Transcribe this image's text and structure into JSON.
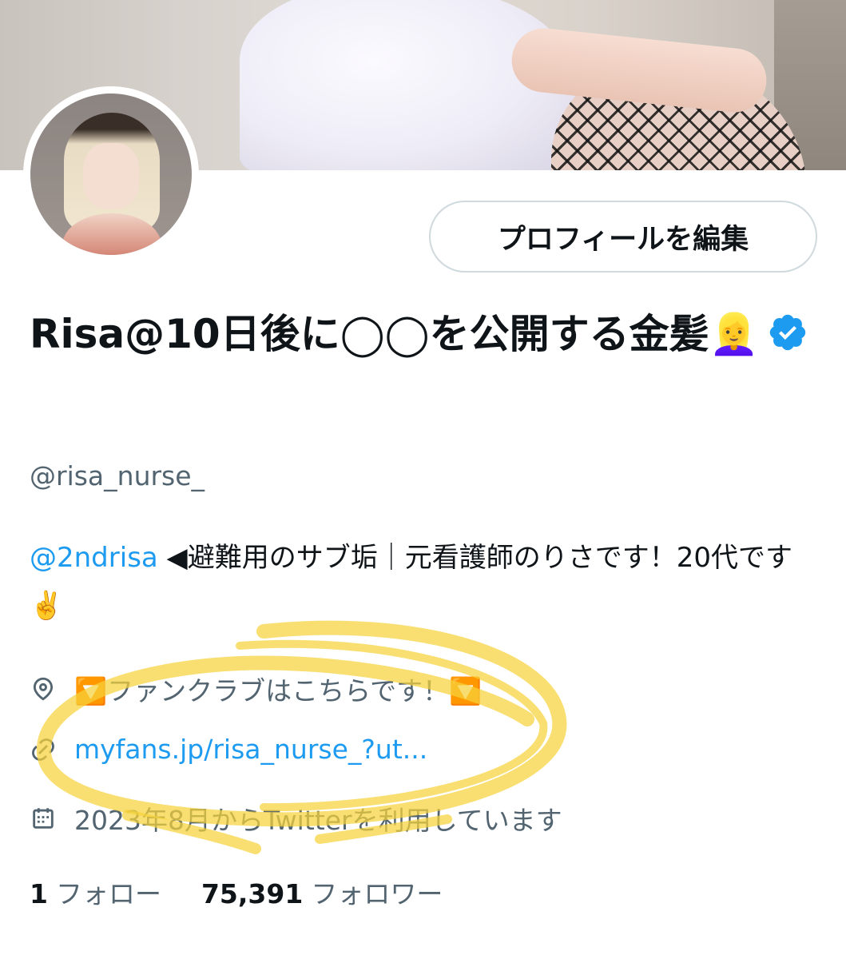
{
  "banner": {
    "alt": ""
  },
  "profile": {
    "edit_button": "プロフィールを編集",
    "display_name": "Risa@10日後に◯◯を公開する金髪👱‍♀️",
    "handle": "@risa_nurse_",
    "bio": {
      "mention": "@2ndrisa",
      "text": " ◀避難用のサブ垢｜元看護師のりさです！20代です✌️"
    },
    "location": "🔽ファンクラブはこちらです！🔽",
    "location_prefix": "",
    "location_text": "ファンクラブはこちらです！",
    "link": "myfans.jp/risa_nurse_?ut...",
    "joined": "2023年8月からTwitterを利用しています",
    "following_count": "1",
    "following_label": "フォロー",
    "followers_count": "75,391",
    "followers_label": "フォロワー"
  },
  "colors": {
    "accent": "#1d9bf0",
    "secondary_text": "#536471",
    "primary_text": "#0f1419",
    "highlight": "#f6d23a"
  },
  "icons": [
    "verified-badge-icon",
    "location-icon",
    "link-icon",
    "calendar-icon"
  ]
}
